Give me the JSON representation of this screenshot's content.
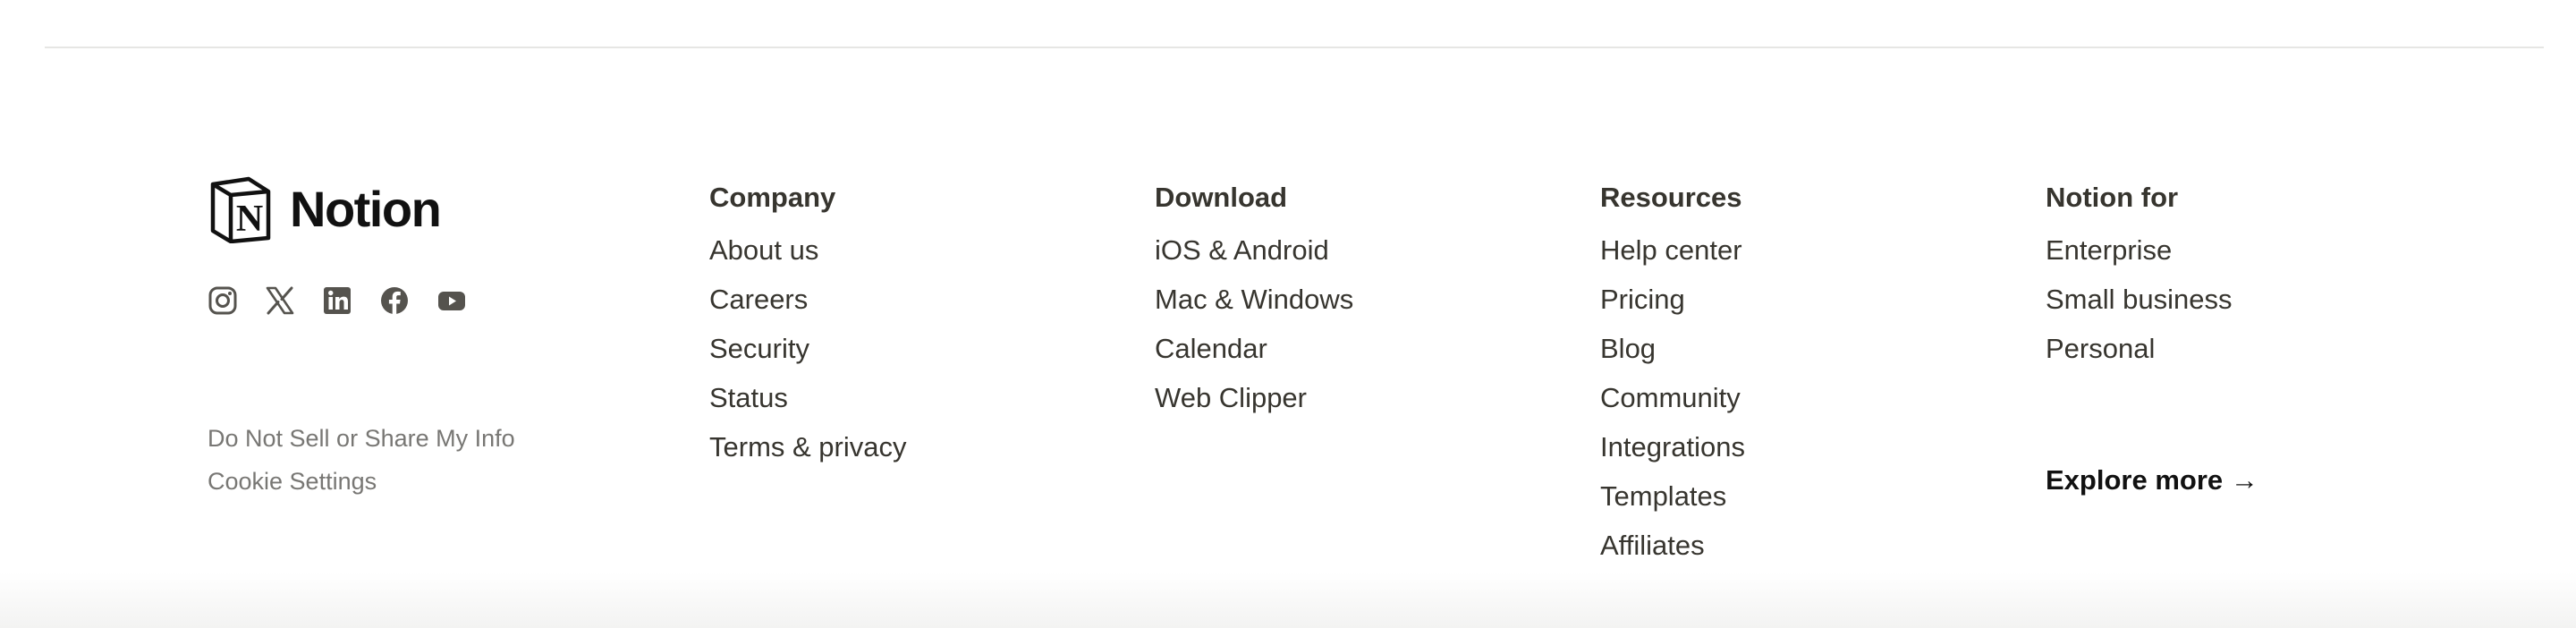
{
  "brand": {
    "name": "Notion",
    "logo_letter": "N",
    "socials": [
      {
        "icon": "instagram-icon"
      },
      {
        "icon": "x-twitter-icon"
      },
      {
        "icon": "linkedin-icon"
      },
      {
        "icon": "facebook-icon"
      },
      {
        "icon": "youtube-icon"
      }
    ],
    "legal_links": [
      "Do Not Sell or Share My Info",
      "Cookie Settings"
    ]
  },
  "columns": [
    {
      "heading": "Company",
      "links": [
        "About us",
        "Careers",
        "Security",
        "Status",
        "Terms & privacy"
      ]
    },
    {
      "heading": "Download",
      "links": [
        "iOS & Android",
        "Mac & Windows",
        "Calendar",
        "Web Clipper"
      ]
    },
    {
      "heading": "Resources",
      "links": [
        "Help center",
        "Pricing",
        "Blog",
        "Community",
        "Integrations",
        "Templates",
        "Affiliates"
      ]
    },
    {
      "heading": "Notion for",
      "links": [
        "Enterprise",
        "Small business",
        "Personal"
      ]
    }
  ],
  "explore_more": "Explore more →",
  "colors": {
    "text": "#37352f",
    "muted": "#787774",
    "icon": "#55534e",
    "divider": "#e6e6e4"
  }
}
